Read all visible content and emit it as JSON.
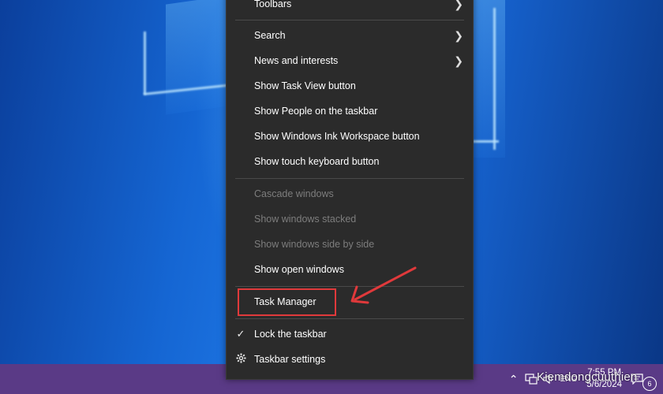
{
  "context_menu": {
    "toolbars": "Toolbars",
    "search": "Search",
    "news_and_interests": "News and interests",
    "show_task_view": "Show Task View button",
    "show_people": "Show People on the taskbar",
    "show_ink_workspace": "Show Windows Ink Workspace button",
    "show_touch_keyboard": "Show touch keyboard button",
    "cascade_windows": "Cascade windows",
    "show_windows_stacked": "Show windows stacked",
    "show_windows_side_by_side": "Show windows side by side",
    "show_open_windows": "Show open windows",
    "task_manager": "Task Manager",
    "lock_taskbar": "Lock the taskbar",
    "taskbar_settings": "Taskbar settings"
  },
  "tray": {
    "time": "7:55 PM",
    "date": "5/6/2024",
    "language": "ENG",
    "notification_count": "6"
  },
  "watermark": "Kiemdongcuuthien",
  "colors": {
    "menu_bg": "#2b2b2b",
    "taskbar_bg": "#5a3a86",
    "highlight": "#e0393b"
  }
}
